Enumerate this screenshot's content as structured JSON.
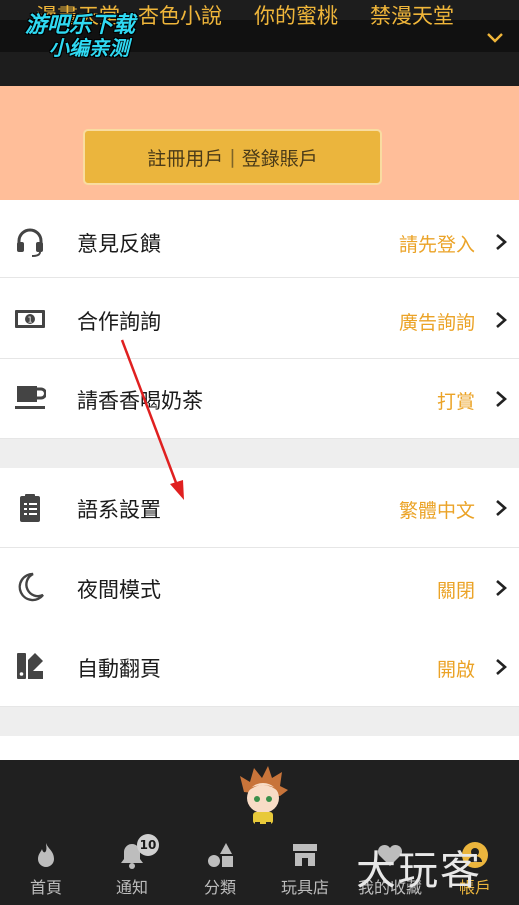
{
  "watermark": {
    "line1": "游吧乐下载",
    "line2": "小编亲测"
  },
  "top_tabs": [
    "漫畫天堂",
    "杏色小說",
    "你的蜜桃",
    "禁漫天堂"
  ],
  "login": {
    "register": "註冊用戶",
    "separator": "|",
    "login": "登錄賬戶"
  },
  "settings": [
    {
      "icon": "headset-icon",
      "label": "意見反饋",
      "value": "請先登入"
    },
    {
      "icon": "cash-icon",
      "label": "合作詢詢",
      "value": "廣告詢詢"
    },
    {
      "icon": "coffee-icon",
      "label": "請香香喝奶茶",
      "value": "打賞"
    },
    {
      "icon": "clipboard-icon",
      "label": "語系設置",
      "value": "繁體中文"
    },
    {
      "icon": "moon-icon",
      "label": "夜間模式",
      "value": "關閉"
    },
    {
      "icon": "auto-page-icon",
      "label": "自動翻頁",
      "value": "開啟"
    }
  ],
  "bottom_nav": [
    {
      "icon": "fire-icon",
      "label": "首頁"
    },
    {
      "icon": "bell-icon",
      "label": "通知",
      "badge": "10"
    },
    {
      "icon": "shapes-icon",
      "label": "分類"
    },
    {
      "icon": "store-icon",
      "label": "玩具店"
    },
    {
      "icon": "heart-icon",
      "label": "我的收藏"
    },
    {
      "icon": "account-icon",
      "label": "帳戶"
    }
  ],
  "brand_overlay": "大玩客",
  "colors": {
    "accent": "#eba327",
    "banner": "#ffbe99",
    "button": "#ebb53d",
    "topbar": "#1d1d1d",
    "arrow": "#e02020"
  }
}
